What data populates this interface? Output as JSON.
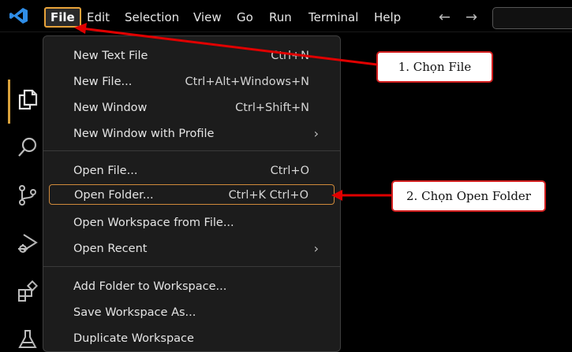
{
  "menubar": {
    "items": [
      "File",
      "Edit",
      "Selection",
      "View",
      "Go",
      "Run",
      "Terminal",
      "Help"
    ],
    "back_arrow": "←",
    "forward_arrow": "→"
  },
  "file_menu": {
    "items": [
      {
        "label": "New Text File",
        "shortcut": "Ctrl+N"
      },
      {
        "label": "New File...",
        "shortcut": "Ctrl+Alt+Windows+N"
      },
      {
        "label": "New Window",
        "shortcut": "Ctrl+Shift+N"
      },
      {
        "label": "New Window with Profile",
        "submenu": "›"
      },
      {
        "label": "Open File...",
        "shortcut": "Ctrl+O"
      },
      {
        "label": "Open Folder...",
        "shortcut": "Ctrl+K Ctrl+O"
      },
      {
        "label": "Open Workspace from File..."
      },
      {
        "label": "Open Recent",
        "submenu": "›"
      },
      {
        "label": "Add Folder to Workspace..."
      },
      {
        "label": "Save Workspace As..."
      },
      {
        "label": "Duplicate Workspace"
      }
    ]
  },
  "annotations": {
    "step1": "1. Chọn File",
    "step2": "2. Chọn Open Folder"
  },
  "colors": {
    "highlight": "#d08a3a",
    "arrow": "#e00000",
    "vscode_blue": "#2f8ee8"
  },
  "icons": [
    "vscode-logo-icon",
    "explorer-icon",
    "search-icon",
    "source-control-icon",
    "run-debug-icon",
    "extensions-icon",
    "testing-icon"
  ]
}
